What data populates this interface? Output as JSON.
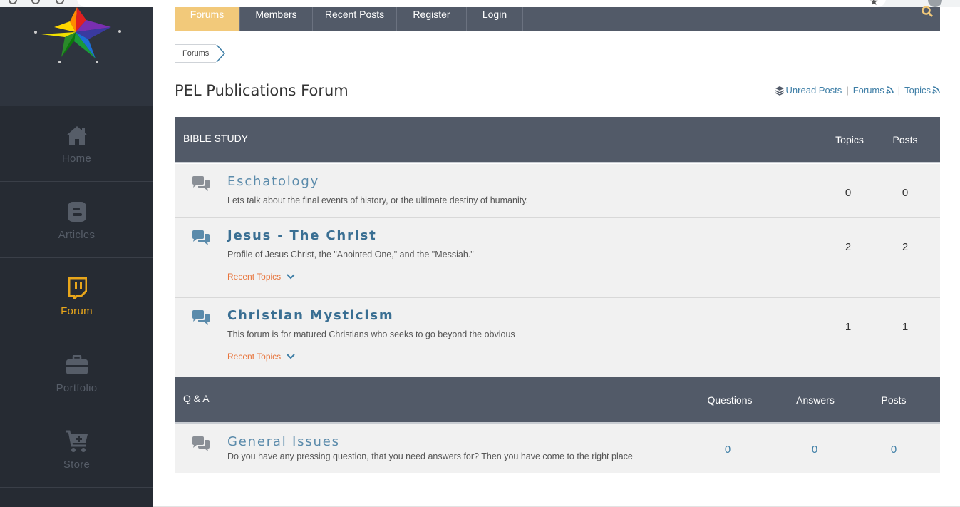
{
  "nav": {
    "tabs": [
      "Forums",
      "Members",
      "Recent Posts",
      "Register",
      "Login"
    ]
  },
  "sidebar": {
    "items": [
      {
        "label": "Home",
        "icon": "home-icon"
      },
      {
        "label": "Articles",
        "icon": "blogger-icon"
      },
      {
        "label": "Forum",
        "icon": "twitch-icon"
      },
      {
        "label": "Portfolio",
        "icon": "briefcase-icon"
      },
      {
        "label": "Store",
        "icon": "cart-plus-icon"
      }
    ],
    "active_color": "#e8a61b"
  },
  "breadcrumb": {
    "label": "Forums"
  },
  "page": {
    "title": "PEL Publications Forum"
  },
  "links": {
    "unread": "Unread Posts",
    "forums": "Forums",
    "topics": "Topics",
    "separator": "|"
  },
  "sections": {
    "bible": {
      "name": "BIBLE STUDY",
      "cols": [
        "Topics",
        "Posts"
      ],
      "forums": [
        {
          "title": "Eschatology",
          "desc": "Lets talk about the final events of history, or the ultimate destiny of humanity.",
          "topics": "0",
          "posts": "0"
        },
        {
          "title": "Jesus - The Christ",
          "desc": "Profile of Jesus Christ, the \"Anointed One,\" and the \"Messiah.\"",
          "recent": "Recent Topics",
          "topics": "2",
          "posts": "2"
        },
        {
          "title": "Christian Mysticism",
          "desc": "This forum is for matured Christians who seeks to go beyond the obvious",
          "recent": "Recent Topics",
          "topics": "1",
          "posts": "1"
        }
      ]
    },
    "qa": {
      "name": "Q & A",
      "cols": [
        "Questions",
        "Answers",
        "Posts"
      ],
      "forums": [
        {
          "title": "General Issues",
          "desc": "Do you have any pressing question, that you need answers for? Then you have come to the right place",
          "questions": "0",
          "answers": "0",
          "posts": "0"
        }
      ]
    }
  },
  "colors": {
    "accent": "#f2c97a",
    "header": "#525a68",
    "link": "#3e7ea6",
    "recent": "#e8743b"
  }
}
